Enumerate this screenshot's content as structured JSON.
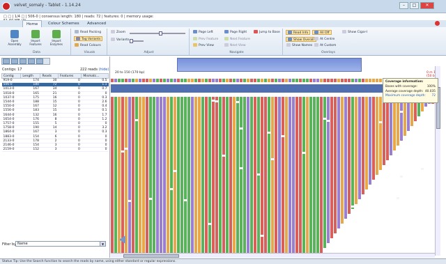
{
  "window": {
    "title": "velvet_somaly - Tablet - 1.14.24",
    "qat_text": "□ □ | 1/4 □ | 506-0 | consensus length: 180 | reads: 72 | features: 0 | memory usage: 51.60 MB (7)"
  },
  "tabs": [
    "Home",
    "Colour Schemes",
    "Advanced"
  ],
  "ribbon": {
    "groups": [
      {
        "label": "Data",
        "buttons": [
          "Open Assembly",
          "Import Features",
          "Import Enzymes"
        ]
      },
      {
        "label": "Visuals",
        "buttons": [
          "Read Packing",
          "Tag Variants",
          "Read Colours"
        ]
      },
      {
        "label": "Adjust",
        "buttons": [
          "Zoom",
          "Variants"
        ]
      },
      {
        "label": "Navigate",
        "buttons": [
          "Page Left",
          "Page Right",
          "Jump to Base",
          "Prev Feature",
          "Next Feature",
          "Prev View",
          "Next View"
        ]
      },
      {
        "label": "Overlays",
        "buttons": [
          "Read Info",
          "All Off",
          "Show Overall",
          "Show Names",
          "At Centre",
          "At Custom",
          "Show Cigar-I"
        ]
      }
    ]
  },
  "left": {
    "contig_label": "Contigs: 17",
    "reads_label": "222 reads",
    "reads_link": "(hide)",
    "columns": [
      "Contig",
      "Length",
      "Reads",
      "Features",
      "Mismatc..."
    ],
    "rows": [
      [
        "919-0",
        "174",
        "30",
        "0",
        "0.5"
      ],
      [
        "506-0",
        "180",
        "72",
        "0",
        "1.1"
      ],
      [
        "1013-0",
        "167",
        "34",
        "0",
        "0.7"
      ],
      [
        "1018-0",
        "165",
        "21",
        "0",
        "0"
      ],
      [
        "1037-0",
        "175",
        "16",
        "0",
        "0.3"
      ],
      [
        "1544-0",
        "188",
        "15",
        "0",
        "2.6"
      ],
      [
        "1550-0",
        "167",
        "12",
        "0",
        "0.4"
      ],
      [
        "1556-0",
        "183",
        "15",
        "0",
        "0.1"
      ],
      [
        "1644-0",
        "132",
        "16",
        "0",
        "1.7"
      ],
      [
        "1654-0",
        "176",
        "8",
        "0",
        "1.2"
      ],
      [
        "1757-0",
        "155",
        "5",
        "0",
        "0"
      ],
      [
        "1758-0",
        "190",
        "14",
        "0",
        "3.2"
      ],
      [
        "1864-0",
        "167",
        "3",
        "0",
        "0.3"
      ],
      [
        "1883-0",
        "154",
        "6",
        "0",
        "0"
      ],
      [
        "2133-0",
        "178",
        "2",
        "0",
        "0"
      ],
      [
        "2146-0",
        "154",
        "3",
        "0",
        "0"
      ],
      [
        "2159-0",
        "152",
        "3",
        "0",
        "0"
      ]
    ],
    "filter_label": "Filter by:",
    "filter_value": "Name"
  },
  "main": {
    "coverage_label": "20 to 150 (170 bp)",
    "right_label": "0 m 1/2 (50 bp)"
  },
  "tooltip": {
    "title": "Coverage information:",
    "rows": [
      {
        "k": "Bases with coverage:",
        "v": "100%"
      },
      {
        "k": "Average coverage depth:",
        "v": "40.035"
      },
      {
        "k": "Maximum coverage depth:",
        "v": "72"
      }
    ]
  },
  "status_text": "Status Tip: Use the Search function to search the reads by name, using either standard or regular expressions.",
  "colors": {
    "A": "#58b35a",
    "C": "#d9605a",
    "G": "#9a7fd0",
    "T": "#e8a84a",
    "selection": "#35679f",
    "ribbon": "#dfe8f3"
  }
}
